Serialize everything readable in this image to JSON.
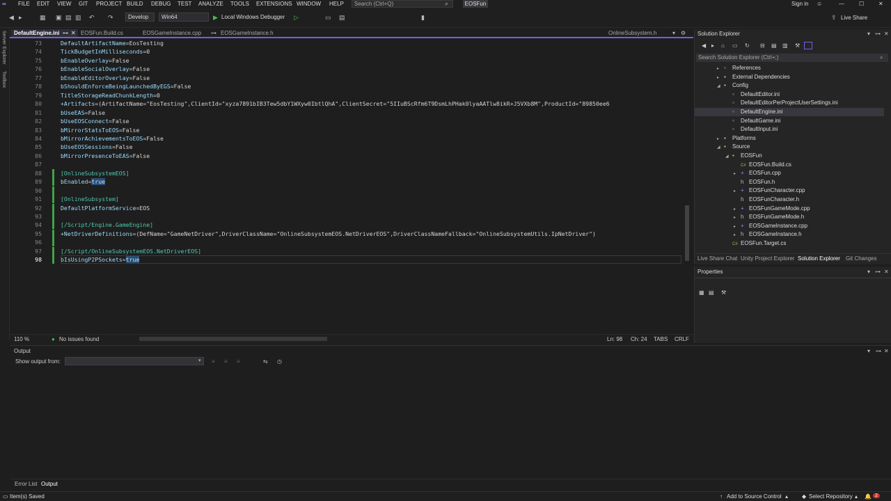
{
  "menu": {
    "items": [
      "FILE",
      "EDIT",
      "VIEW",
      "GIT",
      "PROJECT",
      "BUILD",
      "DEBUG",
      "TEST",
      "ANALYZE",
      "TOOLS",
      "EXTENSIONS",
      "WINDOW",
      "HELP"
    ],
    "search_placeholder": "Search (Ctrl+Q)",
    "project_name": "EOSFun",
    "sign_in": "Sign in"
  },
  "toolbar": {
    "config": "Develop",
    "platform": "Win64",
    "debugger": "Local Windows Debugger",
    "live_share": "Live Share"
  },
  "left_strip": {
    "server_explorer": "Server Explorer",
    "toolbox": "Toolbox"
  },
  "tabs": [
    {
      "label": "DefaultEngine.ini",
      "active": true
    },
    {
      "label": "EOSFun.Build.cs",
      "active": false
    },
    {
      "label": "EOSGameInstance.cpp",
      "active": false
    },
    {
      "label": "EOSGameInstance.h",
      "active": false
    },
    {
      "label": "OnlineSubsystem.h",
      "active": false
    }
  ],
  "code_lines": [
    {
      "n": "73",
      "k": "DefaultArtifactName",
      "v": "=EosTesting"
    },
    {
      "n": "74",
      "k": "TickBudgetInMilliseconds",
      "v": "=0"
    },
    {
      "n": "75",
      "k": "bEnableOverlay",
      "v": "=False"
    },
    {
      "n": "76",
      "k": "bEnableSocialOverlay",
      "v": "=False"
    },
    {
      "n": "77",
      "k": "bEnableEditorOverlay",
      "v": "=False"
    },
    {
      "n": "78",
      "k": "bShouldEnforceBeingLaunchedByEGS",
      "v": "=False"
    },
    {
      "n": "79",
      "k": "TitleStorageReadChunkLength",
      "v": "=0"
    },
    {
      "n": "80",
      "k": "+Artifacts",
      "v": "=(ArtifactName=\"EosTesting\",ClientId=\"xyza7891bIB3Tew5dbY1WXyw0IbtlQhA\",ClientSecret=\"5IIuBScRfm6T9DsmLhPHak0lyaAATlw8ikR+J5VXb8M\",ProductId=\"89850ee6"
    },
    {
      "n": "81",
      "k": "bUseEAS",
      "v": "=False"
    },
    {
      "n": "82",
      "k": "bUseEOSConnect",
      "v": "=False"
    },
    {
      "n": "83",
      "k": "bMirrorStatsToEOS",
      "v": "=False"
    },
    {
      "n": "84",
      "k": "bMirrorAchievementsToEOS",
      "v": "=False"
    },
    {
      "n": "85",
      "k": "bUseEOSSessions",
      "v": "=False"
    },
    {
      "n": "86",
      "k": "bMirrorPresenceToEAS",
      "v": "=False"
    },
    {
      "n": "87",
      "k": "",
      "v": ""
    },
    {
      "n": "88",
      "sec": "[OnlineSubsystemEOS]"
    },
    {
      "n": "89",
      "k": "bEnabled",
      "v": "=",
      "hl": "true"
    },
    {
      "n": "90",
      "k": "",
      "v": ""
    },
    {
      "n": "91",
      "sec": "[OnlineSubsystem]"
    },
    {
      "n": "92",
      "k": "DefaultPlatformService",
      "v": "=EOS"
    },
    {
      "n": "93",
      "k": "",
      "v": ""
    },
    {
      "n": "94",
      "sec": "[/Script/Engine.GameEngine]"
    },
    {
      "n": "95",
      "k": "+NetDriverDefinitions",
      "v": "=(DefName=\"GameNetDriver\",DriverClassName=\"OnlineSubsystemEOS.NetDriverEOS\",DriverClassNameFallback=\"OnlineSubsystemUtils.IpNetDriver\")"
    },
    {
      "n": "96",
      "k": "",
      "v": ""
    },
    {
      "n": "97",
      "sec": "[/Script/OnlineSubsystemEOS.NetDriverEOS]"
    },
    {
      "n": "98",
      "k": "bIsUsingP2PSockets",
      "v": "=",
      "hl": "true"
    }
  ],
  "editor_status": {
    "zoom": "110 %",
    "issues": "No issues found",
    "line": "Ln: 98",
    "col": "Ch: 24",
    "tabs": "TABS",
    "eol": "CRLF"
  },
  "solution_explorer": {
    "title": "Solution Explorer",
    "search_placeholder": "Search Solution Explorer (Ctrl+;)",
    "nodes": [
      {
        "label": "References",
        "depth": 2,
        "arrow": "▸",
        "icon": "▫"
      },
      {
        "label": "External Dependencies",
        "depth": 2,
        "arrow": "▸",
        "icon": "▪"
      },
      {
        "label": "Config",
        "depth": 2,
        "arrow": "◢",
        "icon": "▪"
      },
      {
        "label": "DefaultEditor.ini",
        "depth": 3,
        "arrow": "",
        "icon": "▫"
      },
      {
        "label": "DefaultEditorPerProjectUserSettings.ini",
        "depth": 3,
        "arrow": "",
        "icon": "▫"
      },
      {
        "label": "DefaultEngine.ini",
        "depth": 3,
        "arrow": "",
        "icon": "▫",
        "selected": true
      },
      {
        "label": "DefaultGame.ini",
        "depth": 3,
        "arrow": "",
        "icon": "▫"
      },
      {
        "label": "DefaultInput.ini",
        "depth": 3,
        "arrow": "",
        "icon": "▫"
      },
      {
        "label": "Platforms",
        "depth": 2,
        "arrow": "▸",
        "icon": "▪"
      },
      {
        "label": "Source",
        "depth": 2,
        "arrow": "◢",
        "icon": "▪"
      },
      {
        "label": "EOSFun",
        "depth": 3,
        "arrow": "◢",
        "icon": "▪"
      },
      {
        "label": "EOSFun.Build.cs",
        "depth": 4,
        "arrow": "",
        "icon": "C#"
      },
      {
        "label": "EOSFun.cpp",
        "depth": 4,
        "arrow": "▸",
        "icon": "+"
      },
      {
        "label": "EOSFun.h",
        "depth": 4,
        "arrow": "",
        "icon": "h"
      },
      {
        "label": "EOSFunCharacter.cpp",
        "depth": 4,
        "arrow": "▸",
        "icon": "+"
      },
      {
        "label": "EOSFunCharacter.h",
        "depth": 4,
        "arrow": "",
        "icon": "h"
      },
      {
        "label": "EOSFunGameMode.cpp",
        "depth": 4,
        "arrow": "▸",
        "icon": "+"
      },
      {
        "label": "EOSFunGameMode.h",
        "depth": 4,
        "arrow": "▸",
        "icon": "h"
      },
      {
        "label": "EOSGameInstance.cpp",
        "depth": 4,
        "arrow": "▸",
        "icon": "+"
      },
      {
        "label": "EOSGameInstance.h",
        "depth": 4,
        "arrow": "▸",
        "icon": "h"
      },
      {
        "label": "EOSFun.Target.cs",
        "depth": 3,
        "arrow": "",
        "icon": "C#"
      }
    ],
    "bottom_tabs": [
      "Live Share Chat",
      "Unity Project Explorer",
      "Solution Explorer",
      "Git Changes"
    ]
  },
  "properties": {
    "title": "Properties"
  },
  "output": {
    "title": "Output",
    "show_from": "Show output from:"
  },
  "bottom_tabs": [
    "Error List",
    "Output"
  ],
  "statusbar": {
    "left": "Item(s) Saved",
    "source_control": "Add to Source Control",
    "repository": "Select Repository",
    "notifications": "2"
  }
}
